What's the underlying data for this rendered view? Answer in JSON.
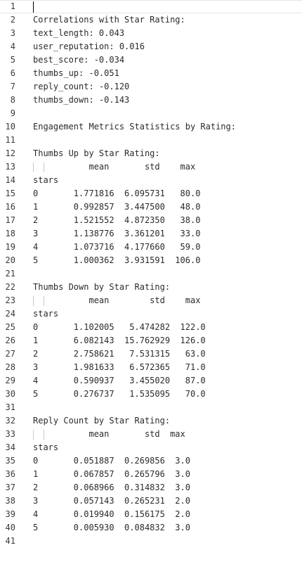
{
  "line_numbers": [
    "1",
    "2",
    "3",
    "4",
    "5",
    "6",
    "7",
    "8",
    "9",
    "10",
    "11",
    "12",
    "13",
    "14",
    "15",
    "16",
    "17",
    "18",
    "19",
    "20",
    "21",
    "22",
    "23",
    "24",
    "25",
    "26",
    "27",
    "28",
    "29",
    "30",
    "31",
    "32",
    "33",
    "34",
    "35",
    "36",
    "37",
    "38",
    "39",
    "40",
    "41"
  ],
  "lines": [
    "",
    "Correlations with Star Rating:",
    "text_length: 0.043",
    "user_reputation: 0.016",
    "best_score: -0.034",
    "thumbs_up: -0.051",
    "reply_count: -0.120",
    "thumbs_down: -0.143",
    "",
    "Engagement Metrics Statistics by Rating:",
    "",
    "Thumbs Up by Star Rating:",
    "           mean       std    max",
    "stars",
    "0       1.771816  6.095731   80.0",
    "1       0.992857  3.447500   48.0",
    "2       1.521552  4.872350   38.0",
    "3       1.138776  3.361201   33.0",
    "4       1.073716  4.177660   59.0",
    "5       1.000362  3.931591  106.0",
    "",
    "Thumbs Down by Star Rating:",
    "           mean        std    max",
    "stars",
    "0       1.102005   5.474282  122.0",
    "1       6.082143  15.762929  126.0",
    "2       2.758621   7.531315   63.0",
    "3       1.981633   6.572365   71.0",
    "4       0.590937   3.455020   87.0",
    "5       0.276737   1.535095   70.0",
    "",
    "Reply Count by Star Rating:",
    "           mean       std  max",
    "stars",
    "0       0.051887  0.269856  3.0",
    "1       0.067857  0.265796  3.0",
    "2       0.068966  0.314832  3.0",
    "3       0.057143  0.265231  2.0",
    "4       0.019940  0.156175  2.0",
    "5       0.005930  0.084832  3.0",
    ""
  ]
}
